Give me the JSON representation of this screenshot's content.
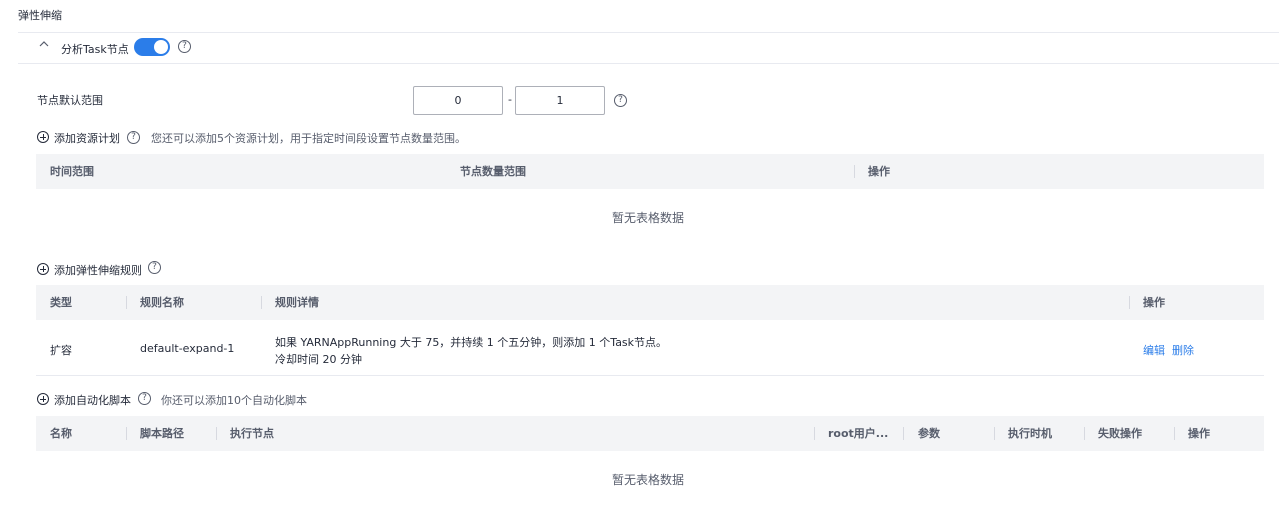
{
  "section_title": "弹性伸缩",
  "task_node": {
    "label": "分析Task节点",
    "enabled": true
  },
  "node_range": {
    "label": "节点默认范围",
    "min": "0",
    "dash": "-",
    "max": "1"
  },
  "resource_plan": {
    "add_label": "添加资源计划",
    "hint": "您还可以添加5个资源计划，用于指定时间段设置节点数量范围。",
    "columns": [
      "时间范围",
      "节点数量范围",
      "操作"
    ],
    "empty": "暂无表格数据"
  },
  "scaling_rules": {
    "add_label": "添加弹性伸缩规则",
    "columns": [
      "类型",
      "规则名称",
      "规则详情",
      "操作"
    ],
    "rows": [
      {
        "type": "扩容",
        "name": "default-expand-1",
        "detail_line1": "如果 YARNAppRunning 大于 75，并持续 1 个五分钟，则添加 1 个Task节点。",
        "detail_line2": "冷却时间 20 分钟",
        "edit": "编辑",
        "delete": "删除"
      }
    ]
  },
  "scripts": {
    "add_label": "添加自动化脚本",
    "hint": "你还可以添加10个自动化脚本",
    "columns": [
      "名称",
      "脚本路径",
      "执行节点",
      "root用户...",
      "参数",
      "执行时机",
      "失败操作",
      "操作"
    ],
    "empty": "暂无表格数据"
  },
  "icons": {
    "collapse": "chevron-up-icon",
    "help": "help-circle-icon",
    "add": "plus-circle-icon"
  },
  "colors": {
    "accent": "#2b7de9",
    "header_bg": "#f3f4f6"
  }
}
